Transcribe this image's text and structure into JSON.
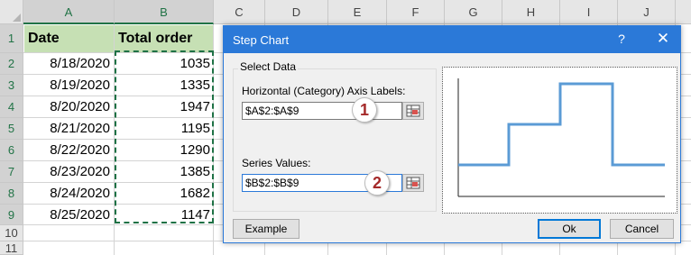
{
  "sheet": {
    "columns": [
      "A",
      "B",
      "C",
      "D",
      "E",
      "F",
      "G",
      "H",
      "I",
      "J"
    ],
    "rows": [
      "1",
      "2",
      "3",
      "4",
      "5",
      "6",
      "7",
      "8",
      "9",
      "10",
      "11"
    ],
    "header": {
      "a": "Date",
      "b": "Total order"
    },
    "data": [
      {
        "date": "8/18/2020",
        "order": "1035"
      },
      {
        "date": "8/19/2020",
        "order": "1335"
      },
      {
        "date": "8/20/2020",
        "order": "1947"
      },
      {
        "date": "8/21/2020",
        "order": "1195"
      },
      {
        "date": "8/22/2020",
        "order": "1290"
      },
      {
        "date": "8/23/2020",
        "order": "1385"
      },
      {
        "date": "8/24/2020",
        "order": "1682"
      },
      {
        "date": "8/25/2020",
        "order": "1147"
      }
    ]
  },
  "dialog": {
    "title": "Step Chart",
    "help": "?",
    "close": "✕",
    "group_title": "Select Data",
    "axis_label": "Horizontal (Category) Axis Labels:",
    "axis_value": "$A$2:$A$9",
    "series_label": "Series Values:",
    "series_value": "$B$2:$B$9",
    "badge1": "1",
    "badge2": "2",
    "example_button": "Example",
    "ok_button": "Ok",
    "cancel_button": "Cancel",
    "accent_color": "#2b79d8",
    "line_color": "#5b9bd5"
  }
}
